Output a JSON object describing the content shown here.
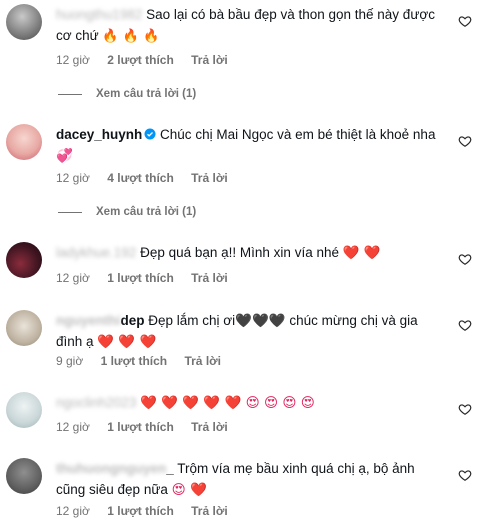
{
  "comments": [
    {
      "username": "huongthu1982",
      "text": "Sao lại có bà bầu đẹp và thon gọn thế này được cơ chứ",
      "emoji": "🔥 🔥 🔥",
      "time": "12 giờ",
      "likes": "2 lượt thích",
      "reply": "Trả lời",
      "view_replies": "Xem câu trả lời (1)"
    },
    {
      "username": "dacey_huynh",
      "text": "Chúc chị Mai Ngọc và em bé thiệt là khoẻ nha",
      "emoji": "💞",
      "time": "12 giờ",
      "likes": "4 lượt thích",
      "reply": "Trả lời",
      "view_replies": "Xem câu trả lời (1)"
    },
    {
      "username": "ladykhue.192",
      "text": "Đẹp quá bạn ạ!! Mình xin vía nhé",
      "emoji": "❤️ ❤️",
      "time": "12 giờ",
      "likes": "1 lượt thích",
      "reply": "Trả lời"
    },
    {
      "username_blur": "nguyenthi",
      "username_visible": "dep",
      "text": "Đẹp lắm chị ơi🖤🖤🖤 chúc mừng chị và gia đình ạ",
      "emoji": "❤️ ❤️ ❤️",
      "time": "9 giờ",
      "likes": "1 lượt thích",
      "reply": "Trả lời"
    },
    {
      "username": "ngoclinh2023",
      "text": "",
      "emoji": "❤️ ❤️ ❤️ ❤️ ❤️ 😍 😍 😍 😍",
      "time": "12 giờ",
      "likes": "1 lượt thích",
      "reply": "Trả lời"
    },
    {
      "username_blur": "thuhuongnguyen",
      "username_visible": "_",
      "text": "Trộm vía mẹ bầu xinh quá chị ạ, bộ ảnh cũng siêu đẹp nữa",
      "emoji": "😍 ❤️",
      "time": "12 giờ",
      "likes": "1 lượt thích",
      "reply": "Trả lời"
    }
  ],
  "colors": {
    "meta": "#737373",
    "verified": "#0095f6",
    "text": "#0f1419"
  },
  "icons": [
    "heart-outline-icon",
    "verified-badge-icon",
    "avatar"
  ]
}
